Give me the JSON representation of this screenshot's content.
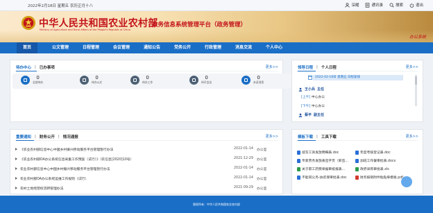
{
  "topbar": {
    "date": "2022年2月18日 星期五 农历正月十八",
    "links": [
      {
        "label": "深耀",
        "icon": "user-icon"
      },
      {
        "label": "通讯录",
        "icon": "address-book-icon"
      },
      {
        "label": "搜索",
        "icon": "search-icon"
      },
      {
        "label": "退出",
        "icon": "power-icon"
      }
    ]
  },
  "header": {
    "title_cn": "中华人民共和国农业农村部",
    "title_en": "Ministry of Agriculture and Rural Affairs of the People's Republic of China",
    "subtitle": "政务信息系统管理平台（政务管理）",
    "stamp": "办公系统"
  },
  "nav": {
    "items": [
      "首页",
      "公文管理",
      "日程管理",
      "会议管理",
      "通知公告",
      "党务公开",
      "行政管理",
      "消息交流",
      "个人中心"
    ],
    "active_index": 0
  },
  "todo": {
    "tabs": [
      "待办中心",
      "已办事项"
    ],
    "more": "更多>>",
    "stats": [
      {
        "value": "0",
        "label": "全部待办",
        "icon": "inbox-icon"
      },
      {
        "value": "0",
        "label": "待办公文",
        "icon": "document-icon"
      },
      {
        "value": "0",
        "label": "待办工作",
        "icon": "task-icon"
      },
      {
        "value": "0",
        "label": "待开会议",
        "icon": "meeting-icon"
      },
      {
        "value": "0",
        "label": "未读消息",
        "icon": "mail-icon"
      }
    ]
  },
  "leader": {
    "tabs": [
      "领导日程",
      "个人日程"
    ],
    "more": "更多>>",
    "date_label": "2022-02-18日 星期五 日程安排",
    "entries": [
      {
        "name": "王小兵",
        "role": "主任",
        "items": [
          {
            "period": "[上午]",
            "text": "中心办公"
          },
          {
            "period": "[下午]",
            "text": "中心办公"
          }
        ]
      },
      {
        "name": "蔡平",
        "role": "副主任",
        "items": []
      }
    ]
  },
  "notices": {
    "tabs": [
      "重要通知",
      "财务公开",
      "情况通报"
    ],
    "more": "更多>>",
    "rows": [
      {
        "title": "《农业农村部信息中心中国乡村振兴移动服务平台管理暂行办法",
        "date": "2022-01-14",
        "source": "办公室"
      },
      {
        "title": "《农业农村部OA办公系统信息采集工作预案（试行）》（农信息[2020]10号）",
        "date": "2021-12-29",
        "source": "办公室"
      },
      {
        "title": "农业农村部信息中心中国乡村振兴移动服务平台管理暂行办法",
        "date": "2022-01-14",
        "source": "办公室"
      },
      {
        "title": "农业农村部OA办公系统运维工作规则（试行）",
        "date": "2022-01-14",
        "source": "办公室"
      },
      {
        "title": "农村土地经营权流转管理办法",
        "date": "2021-09-29",
        "source": "办公室"
      }
    ]
  },
  "templates": {
    "tabs": [
      "模板下载",
      "工具下载"
    ],
    "more": "更多>>",
    "items": [
      {
        "name": "续写工资发放明细表.doc",
        "type": "doc"
      },
      {
        "name": "年度考核登记表.doc",
        "type": "doc"
      },
      {
        "name": "专家劳务发放表签字页（新签...",
        "type": "doc"
      },
      {
        "name": "加班工作餐审批表.docx",
        "type": "doc"
      },
      {
        "name": "关于职工药费单据审核报表...",
        "type": "xls"
      },
      {
        "name": "政府采购审批表.xls",
        "type": "xls"
      },
      {
        "name": "不能同公务-扶贫保审批表.doc",
        "type": "doc"
      },
      {
        "name": "财务报销附件粘贴单模板.pdf",
        "type": "pdf"
      }
    ]
  },
  "footer": {
    "text": "版权所有：中华人民共和国农业农村部"
  },
  "colors": {
    "primary": "#1a6ec6",
    "brand_red": "#c3121a"
  }
}
